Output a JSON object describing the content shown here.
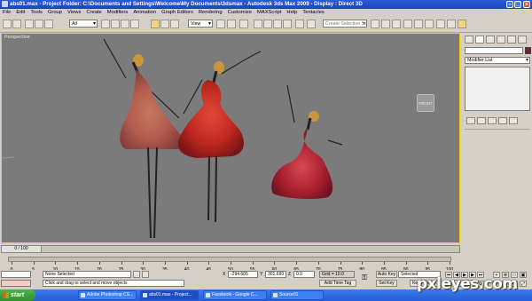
{
  "window": {
    "title": "abs01.max     - Project Folder: C:\\Documents and Settings\\Welcome\\My Documents\\3dsmax     - Autodesk 3ds Max  2009        - Display : Direct 3D"
  },
  "menu": [
    "File",
    "Edit",
    "Tools",
    "Group",
    "Views",
    "Create",
    "Modifiers",
    "Animation",
    "Graph Editors",
    "Rendering",
    "Customize",
    "MAXScript",
    "Help",
    "Tentacles"
  ],
  "toolbar": {
    "selection_filter": "All",
    "ref_coord": "View",
    "named_selection_placeholder": "Create Selection Set"
  },
  "viewport": {
    "label": "Perspective",
    "viewcube_face": "FRONT",
    "colors": {
      "border_active": "#f0d000",
      "background": "#7b7b7b"
    }
  },
  "command_panel": {
    "modifier_list": "Modifier List",
    "object_color": "#7a1c2e"
  },
  "timeline": {
    "position": "0 / 100",
    "ticks": [
      "0",
      "5",
      "10",
      "15",
      "20",
      "25",
      "30",
      "35",
      "40",
      "45",
      "50",
      "55",
      "60",
      "65",
      "70",
      "75",
      "80",
      "85",
      "90",
      "95",
      "100"
    ]
  },
  "status": {
    "selection": "None Selected",
    "prompt": "Click and drag to select and move objects",
    "x_label": "X",
    "x_value": "-294.605",
    "y_label": "Y",
    "y_value": "301.699",
    "z_label": "Z",
    "z_value": "0.0",
    "grid": "Grid = 10.0",
    "add_time_tag": "Add Time Tag",
    "auto_key": "Auto Key",
    "auto_key_mode": "Selected",
    "set_key": "Set Key",
    "key_filters": "Key Filters...",
    "frame_value": "0"
  },
  "taskbar": {
    "start": "start",
    "tasks": [
      "Adobe Photoshop CS...",
      "abs01.max - Project...",
      "Facebook - Google C...",
      "Source01"
    ]
  },
  "watermark": "pxleyes.com"
}
